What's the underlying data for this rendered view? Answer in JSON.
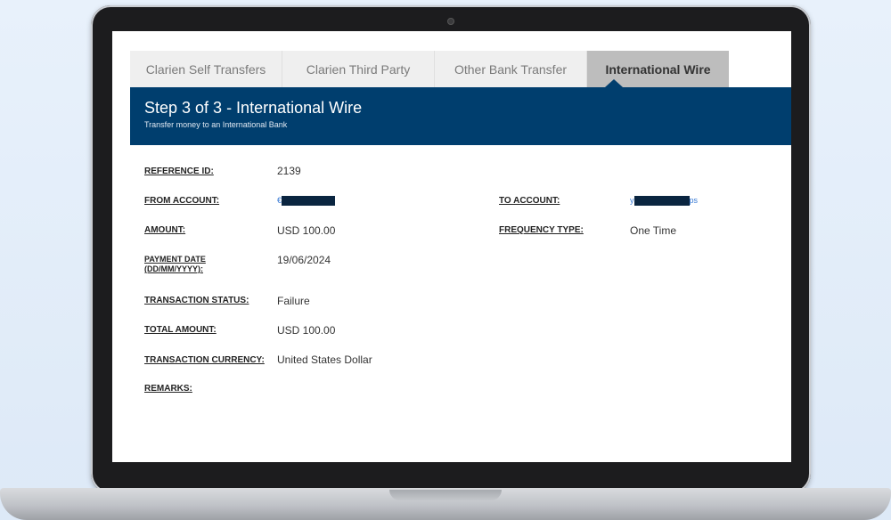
{
  "tabs": [
    {
      "label": "Clarien Self Transfers",
      "active": false
    },
    {
      "label": "Clarien Third Party",
      "active": false
    },
    {
      "label": "Other Bank Transfer",
      "active": false
    },
    {
      "label": "International Wire",
      "active": true
    }
  ],
  "header": {
    "title": "Step 3 of 3 - International Wire",
    "subtitle": "Transfer money to an International Bank"
  },
  "details": {
    "reference_id": {
      "label": "REFERENCE ID:",
      "value": "2139"
    },
    "from_account": {
      "label": "FROM ACCOUNT:",
      "value_prefix": "€"
    },
    "to_account": {
      "label": "TO ACCOUNT:",
      "value_prefix": "y",
      "value_suffix": "ps"
    },
    "amount": {
      "label": "AMOUNT:",
      "value": "USD 100.00"
    },
    "frequency_type": {
      "label": "FREQUENCY TYPE:",
      "value": "One Time"
    },
    "payment_date": {
      "label_line1": "PAYMENT DATE",
      "label_line2": "(DD/MM/YYYY):",
      "value": "19/06/2024"
    },
    "transaction_status": {
      "label": "TRANSACTION STATUS:",
      "value": "Failure"
    },
    "total_amount": {
      "label": "TOTAL AMOUNT:",
      "value": "USD 100.00"
    },
    "transaction_currency": {
      "label": "TRANSACTION CURRENCY:",
      "value": "United States Dollar"
    },
    "remarks": {
      "label": "REMARKS:",
      "value": ""
    }
  },
  "colors": {
    "banner": "#003e6e",
    "active_tab": "#bdbdbd",
    "inactive_tab": "#efefef",
    "link": "#3a7bd5"
  }
}
